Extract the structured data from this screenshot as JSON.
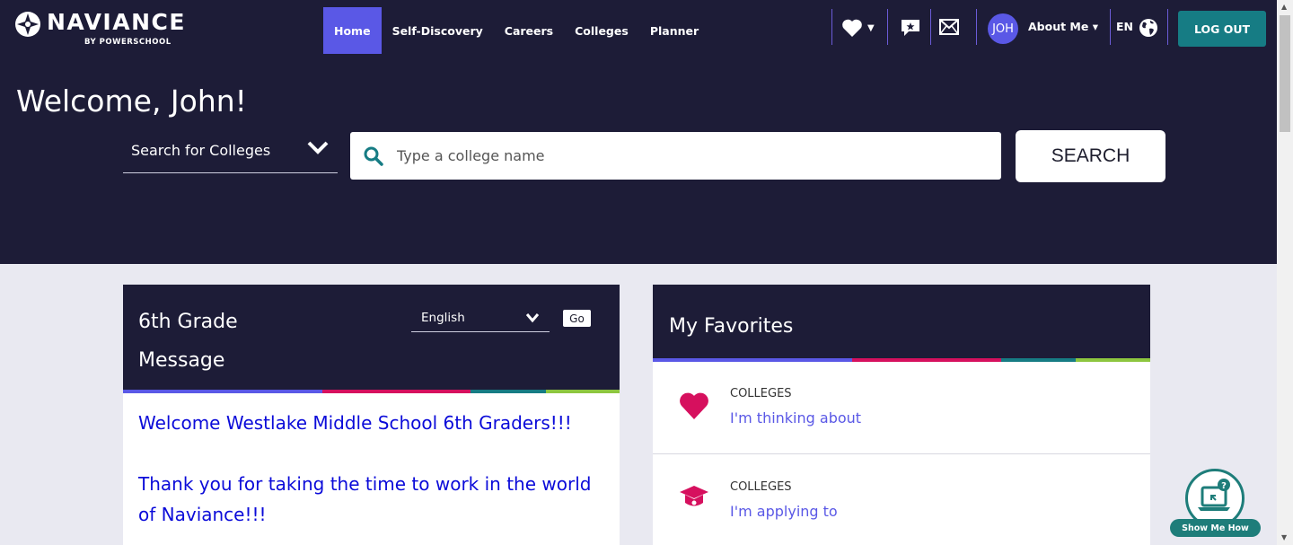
{
  "brand": {
    "name": "NAVIANCE",
    "sub": "BY POWERSCHOOL"
  },
  "nav": [
    {
      "label": "Home",
      "active": true
    },
    {
      "label": "Self-Discovery",
      "active": false
    },
    {
      "label": "Careers",
      "active": false
    },
    {
      "label": "Colleges",
      "active": false
    },
    {
      "label": "Planner",
      "active": false
    }
  ],
  "user": {
    "initials": "JOH",
    "about_label": "About Me ▾"
  },
  "language": {
    "code": "EN"
  },
  "logout_label": "LOG OUT",
  "welcome": "Welcome, John!",
  "search": {
    "type_label": "Search for Colleges",
    "placeholder": "Type a college name",
    "button_label": "SEARCH"
  },
  "message_card": {
    "title": "6th Grade Message",
    "language_select": "English",
    "go_label": "Go",
    "lines": [
      "Welcome Westlake Middle School 6th Graders!!!",
      "Thank you for taking the time to work in the world",
      "of Naviance!!!"
    ]
  },
  "favorites": {
    "title": "My Favorites",
    "items": [
      {
        "category": "COLLEGES",
        "label": "I'm thinking about",
        "icon": "heart-icon"
      },
      {
        "category": "COLLEGES",
        "label": "I'm applying to",
        "icon": "graduation-cap-icon"
      }
    ]
  },
  "show_me_how": "Show Me How",
  "colors": {
    "header_bg": "#1d1c37",
    "accent_purple": "#5a58e6",
    "logout_teal": "#167c84",
    "heart_pink": "#d6105e",
    "message_blue": "#0b0bd9",
    "stripe": [
      "#5a58e6",
      "#d6105e",
      "#167c84",
      "#8dc63f"
    ]
  }
}
